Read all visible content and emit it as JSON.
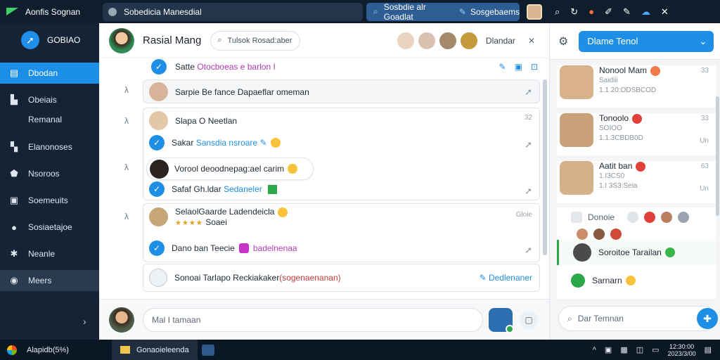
{
  "app": {
    "name": "Aonfis Sognan"
  },
  "titlebar": {
    "window_title": "Sobedicia Manesdial",
    "search_text": "Sosbdie alr Goadlat",
    "search_tag": "Sosgebaems"
  },
  "sidebar": {
    "logo_text": "GOBIAO",
    "items": [
      {
        "label": "Dbodan",
        "icon": "inbox-icon",
        "active": true
      },
      {
        "label": "Obeiais",
        "icon": "document-icon"
      },
      {
        "label": "Remanal",
        "icon": "none",
        "sub": true
      },
      {
        "label": "Elanonoses",
        "icon": "file-icon"
      },
      {
        "label": "Nsoroos",
        "icon": "tag-icon"
      },
      {
        "label": "Soemeuits",
        "icon": "square-icon"
      },
      {
        "label": "Sosiaetajoe",
        "icon": "user-icon"
      },
      {
        "label": "Neanle",
        "icon": "gear-icon"
      },
      {
        "label": "Meers",
        "icon": "people-icon",
        "highlighted": true
      }
    ]
  },
  "chat": {
    "title": "Rasial Mang",
    "search_placeholder": "Tulsok Rosad:aber",
    "participants_label": "Dlandar",
    "top_message": {
      "prefix": "Satte",
      "highlight": "Otocboeas e barlon I"
    },
    "grey_card": {
      "text": "Sarpie Be fance Dapaeflar omeman"
    },
    "card1": {
      "name": "Slapa O Neetlan",
      "count": "32",
      "line1_prefix": "Sakar",
      "line1_link": "Sansdia nsroare",
      "bubble_text": "Vorool deoodnepag:ael carim",
      "line3_prefix": "Safaf Gh.ldar",
      "line3_link": "Sedaneler"
    },
    "card2": {
      "name": "SelaolGaarde Ladendeicla",
      "count": "Gloie",
      "rating_text": "Soaei",
      "line2_prefix": "Dano ban Teecie",
      "line2_link": "badelnenaa"
    },
    "card3": {
      "text_prefix": "Sonoai Tarlapo Reckiakaker",
      "text_red": "(sogenaenanan)",
      "action": "Dedlenaner"
    },
    "input_placeholder": "Mal I tamaan"
  },
  "right": {
    "selector": "Dlame Tenol",
    "contacts": [
      {
        "name": "Nonool Mam",
        "sub": "Saidiii",
        "sub2": "1.1 20:ODSBCOD",
        "count": "33",
        "unread": ""
      },
      {
        "name": "Tonoolo",
        "sub": "SOIOO",
        "sub2": "1.1.3CBDB0D",
        "count": "33",
        "unread": "Un"
      },
      {
        "name": "Aatit ban",
        "sub": "1.I3CS0",
        "sub2": "1.I 3S3:Seia",
        "count": "63",
        "unread": "Un"
      }
    ],
    "group_label": "Donoie",
    "group_items": [
      "Soroitoe Tarailan",
      "Sarnarn"
    ],
    "footer_placeholder": "Dar Temnan"
  },
  "taskbar": {
    "start_label": "Alapidb(5%)",
    "task_label": "Gonaoieleenda",
    "clock_line1": "12:30:00",
    "clock_line2": "2023/3/00"
  }
}
